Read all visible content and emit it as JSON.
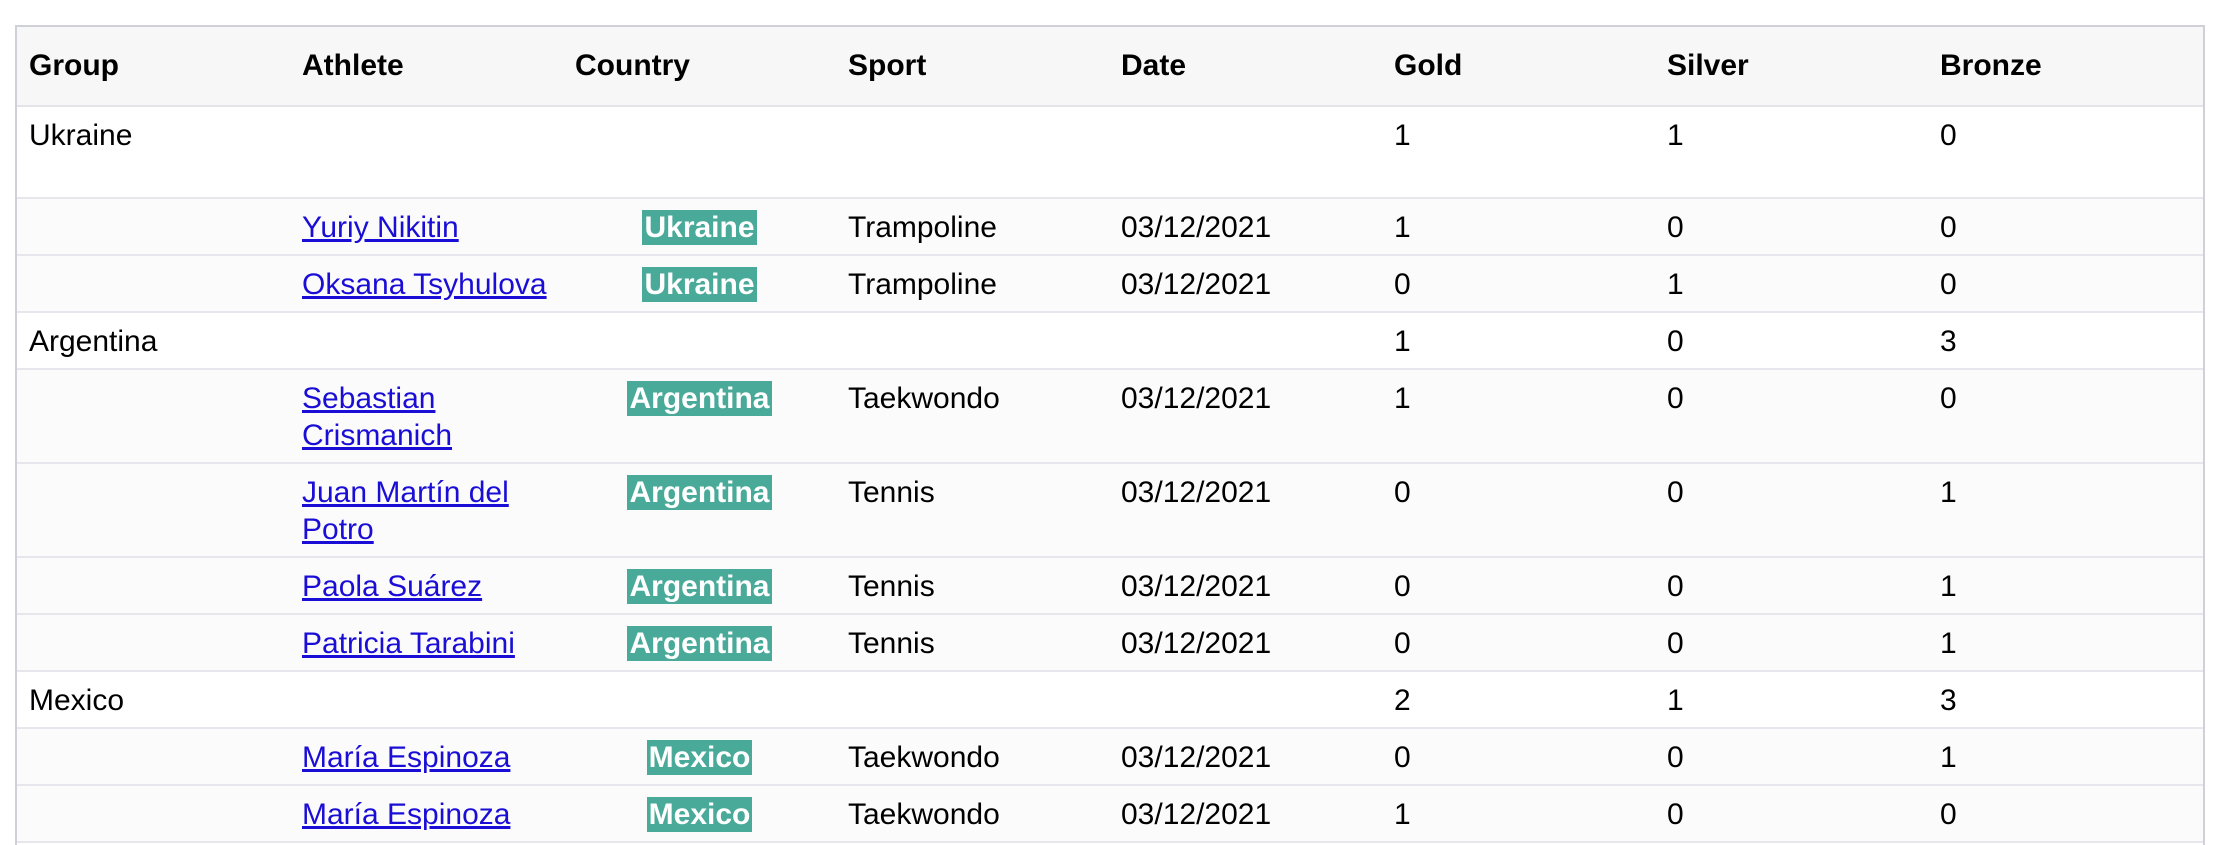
{
  "columns": [
    "Group",
    "Athlete",
    "Country",
    "Sport",
    "Date",
    "Gold",
    "Silver",
    "Bronze"
  ],
  "groups": [
    {
      "name": "Ukraine",
      "gold": "1",
      "silver": "1",
      "bronze": "0",
      "rows": [
        {
          "athlete": "Yuriy Nikitin",
          "country": "Ukraine",
          "sport": "Trampoline",
          "date": "03/12/2021",
          "gold": "1",
          "silver": "0",
          "bronze": "0"
        },
        {
          "athlete": "Oksana Tsyhulova",
          "country": "Ukraine",
          "sport": "Trampoline",
          "date": "03/12/2021",
          "gold": "0",
          "silver": "1",
          "bronze": "0"
        }
      ]
    },
    {
      "name": "Argentina",
      "gold": "1",
      "silver": "0",
      "bronze": "3",
      "rows": [
        {
          "athlete": "Sebastian Crismanich",
          "country": "Argentina",
          "sport": "Taekwondo",
          "date": "03/12/2021",
          "gold": "1",
          "silver": "0",
          "bronze": "0"
        },
        {
          "athlete": "Juan Martín del Potro",
          "country": "Argentina",
          "sport": "Tennis",
          "date": "03/12/2021",
          "gold": "0",
          "silver": "0",
          "bronze": "1"
        },
        {
          "athlete": "Paola Suárez",
          "country": "Argentina",
          "sport": "Tennis",
          "date": "03/12/2021",
          "gold": "0",
          "silver": "0",
          "bronze": "1"
        },
        {
          "athlete": "Patricia Tarabini",
          "country": "Argentina",
          "sport": "Tennis",
          "date": "03/12/2021",
          "gold": "0",
          "silver": "0",
          "bronze": "1"
        }
      ]
    },
    {
      "name": "Mexico",
      "gold": "2",
      "silver": "1",
      "bronze": "3",
      "rows": [
        {
          "athlete": "María Espinoza",
          "country": "Mexico",
          "sport": "Taekwondo",
          "date": "03/12/2021",
          "gold": "0",
          "silver": "0",
          "bronze": "1"
        },
        {
          "athlete": "María Espinoza",
          "country": "Mexico",
          "sport": "Taekwondo",
          "date": "03/12/2021",
          "gold": "1",
          "silver": "0",
          "bronze": "0"
        }
      ]
    }
  ],
  "colors": {
    "badge": "#4aaa99",
    "link": "#1a0dd6",
    "header_bg": "#f7f7f7"
  }
}
